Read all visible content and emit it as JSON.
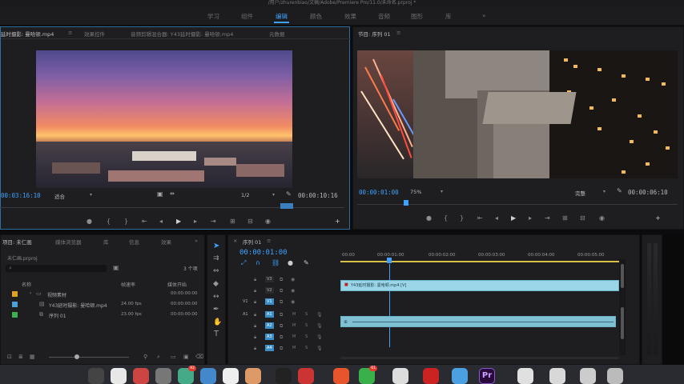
{
  "window": {
    "title": "/用户/zhurenbiao/文稿/Adobe/Premiere Pro/11.0/未命名.prproj *"
  },
  "workspaces": {
    "items": [
      "学习",
      "组件",
      "编辑",
      "颜色",
      "效果",
      "音频",
      "图形",
      "库"
    ],
    "active": "编辑",
    "more": "»"
  },
  "source": {
    "tabs": [
      "延时摄影: 曼哈顿.mp4",
      "效果控件",
      "音频剪辑混合器: Y43延时摄影: 曼哈顿.mp4",
      "元数据"
    ],
    "menu_icon": "≡",
    "timecode_in": "00:03:16:10",
    "fit": "适合",
    "resolution": "1/2",
    "timecode_dur": "00:00:10:16"
  },
  "program": {
    "title": "节目: 序列 01",
    "menu_icon": "≡",
    "timecode": "00:00:01:00",
    "zoom": "75%",
    "quality": "完整",
    "duration": "00:00:06:10"
  },
  "project": {
    "tabs": [
      "项目: 未仁画",
      "媒体浏览器",
      "库",
      "信息",
      "效果"
    ],
    "more": "»",
    "file": "未仁画.prproj",
    "count": "3 个项",
    "columns": [
      "名称",
      "帧速率",
      "媒体开始"
    ],
    "rows": [
      {
        "name": "视频素材",
        "fps": "",
        "start": "00:00:00:00",
        "color": "#e0a020"
      },
      {
        "name": "Y43延时摄影: 曼哈顿.mp4",
        "fps": "24.00 fps",
        "start": "00:00:00:00",
        "color": "#4aa0d8"
      },
      {
        "name": "序列 01",
        "fps": "23.00 fps",
        "start": "00:00:00:00",
        "color": "#3cb050"
      }
    ]
  },
  "timeline": {
    "tab": "序列 01",
    "menu_icon": "≡",
    "timecode": "00:00:01:00",
    "ruler": [
      "00:00",
      "00:00:01:00",
      "00:00:02:00",
      "00:00:03:00",
      "00:00:04:00",
      "00:00:05:00"
    ],
    "video_tracks": [
      "V3",
      "V2",
      "V1"
    ],
    "audio_tracks": [
      "A1",
      "A2",
      "A3",
      "A4"
    ],
    "src_patch_v": "V1",
    "src_patch_a": "A1",
    "clip_label": "Y43延时摄影: 曼哈顿.mp4 [V]",
    "m_label": "M",
    "s_label": "S"
  },
  "dock": {
    "badges": [
      "92",
      "61"
    ],
    "pr_label": "Pr"
  },
  "colors": {
    "accent": "#3ea3ff",
    "panel": "#1e1e21",
    "clip": "#9ad6e8"
  }
}
